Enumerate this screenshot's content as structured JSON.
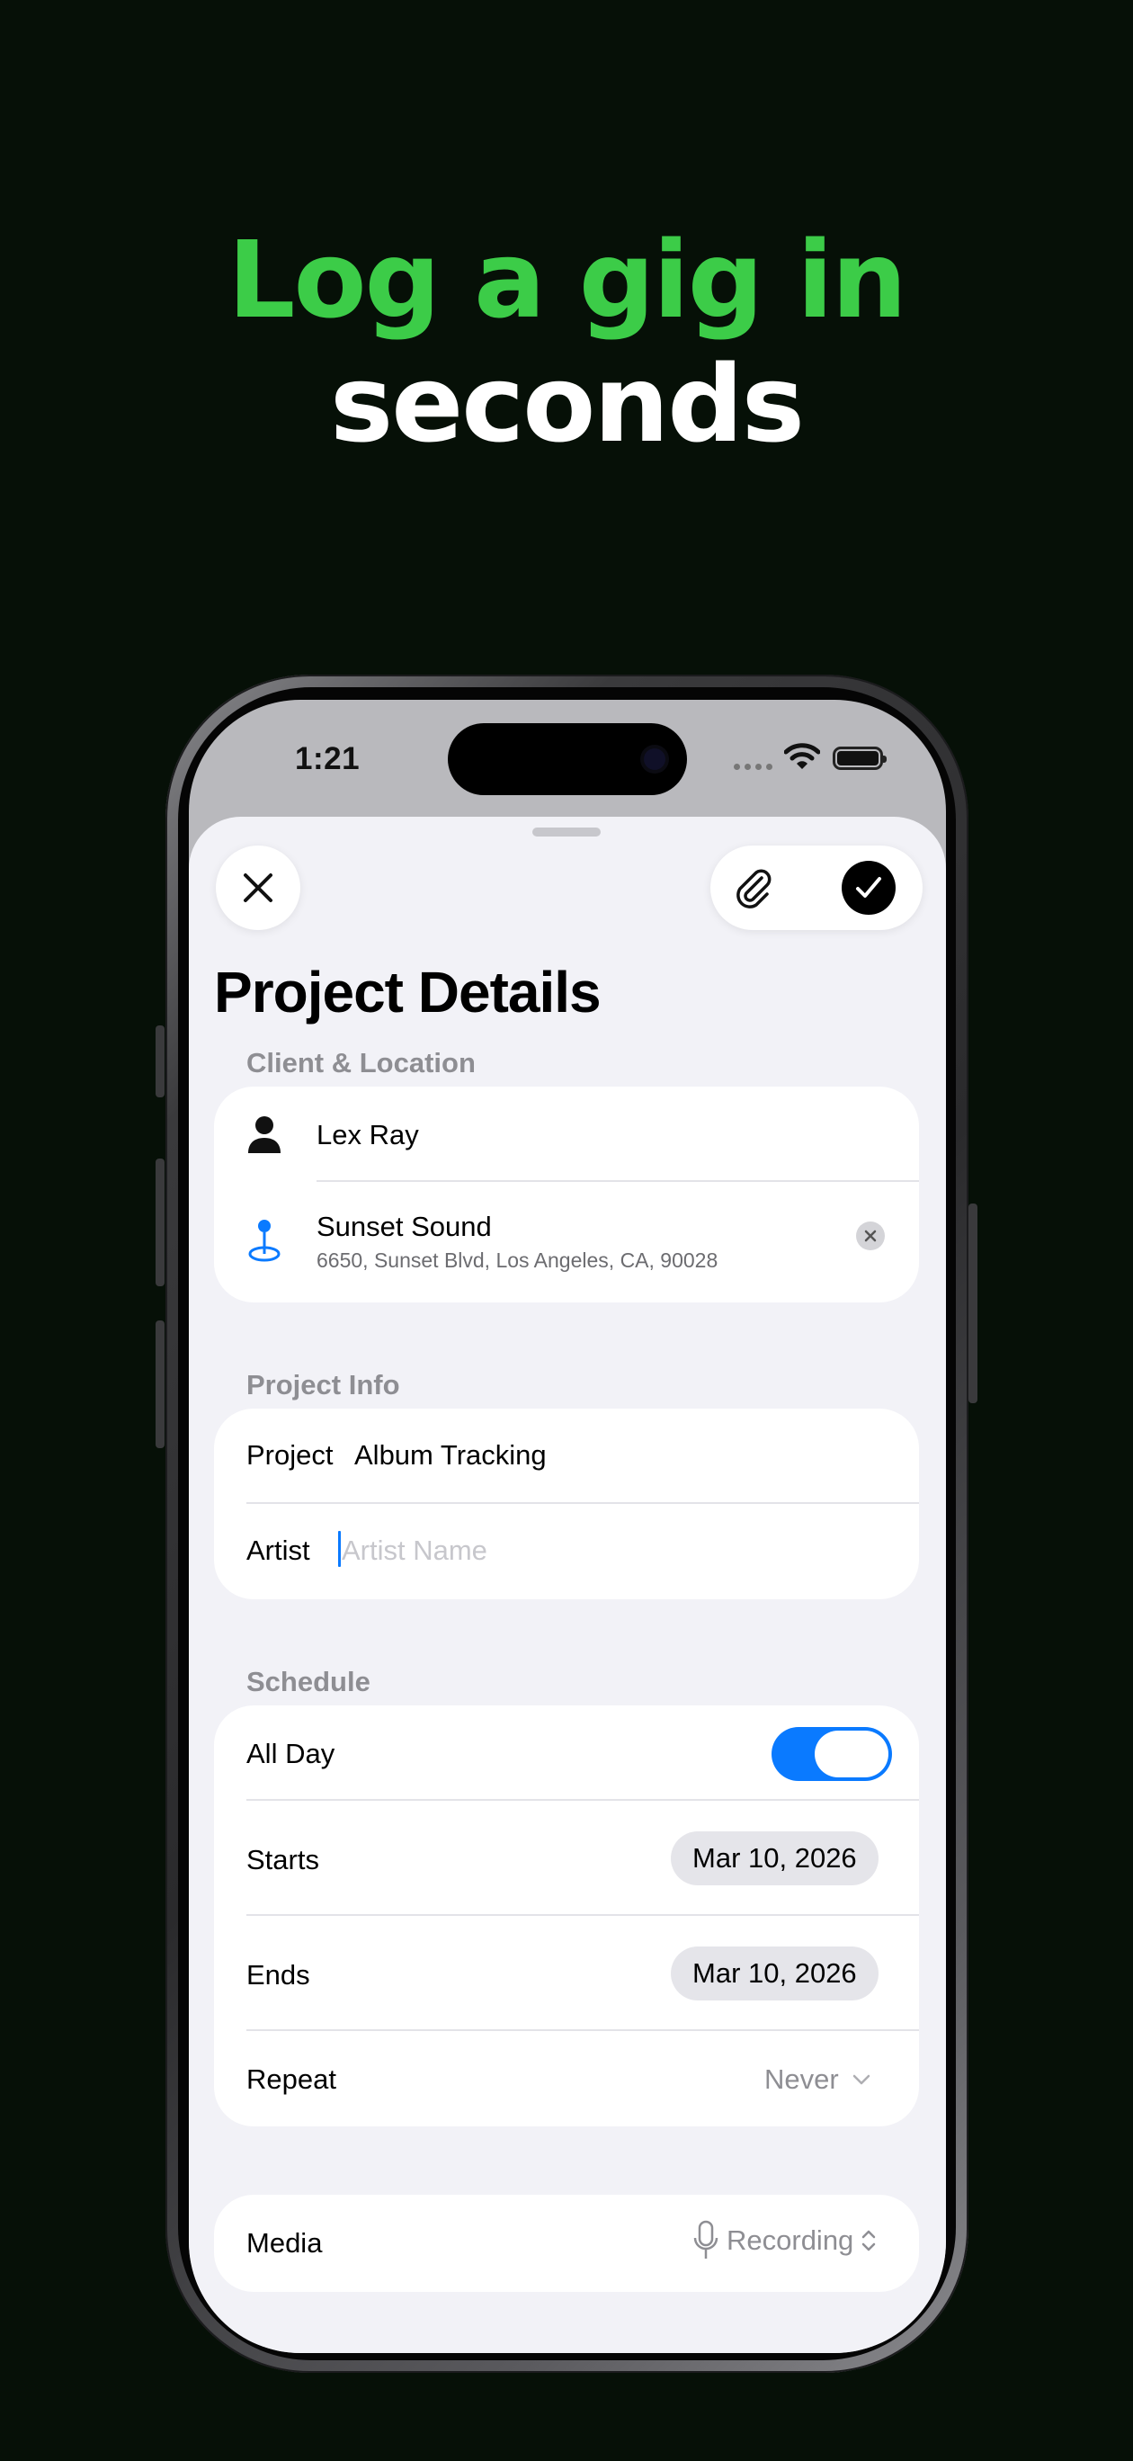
{
  "headline": {
    "line1": "Log a gig in",
    "line2": "seconds"
  },
  "status_bar": {
    "time": "1:21",
    "icons": [
      "signal-icon",
      "wifi-icon",
      "battery-icon"
    ]
  },
  "toolbar": {
    "close_icon": "close-icon",
    "attach_icon": "paperclip-icon",
    "confirm_icon": "checkmark-icon"
  },
  "page": {
    "title": "Project Details"
  },
  "client_location": {
    "header": "Client & Location",
    "client": {
      "icon": "person-icon",
      "name": "Lex Ray"
    },
    "location": {
      "icon": "map-pin-icon",
      "name": "Sunset Sound",
      "address": "6650, Sunset Blvd, Los Angeles, CA, 90028"
    }
  },
  "project_info": {
    "header": "Project Info",
    "project": {
      "label": "Project",
      "value": "Album Tracking"
    },
    "artist": {
      "label": "Artist",
      "value": "",
      "placeholder": "Artist Name"
    }
  },
  "schedule": {
    "header": "Schedule",
    "all_day": {
      "label": "All Day",
      "on": true
    },
    "starts": {
      "label": "Starts",
      "value": "Mar 10, 2026"
    },
    "ends": {
      "label": "Ends",
      "value": "Mar 10, 2026"
    },
    "repeat": {
      "label": "Repeat",
      "value": "Never"
    }
  },
  "media": {
    "label": "Media",
    "value": "Recording",
    "icon": "microphone-icon"
  },
  "colors": {
    "accent_green": "#3ccc48",
    "accent_blue": "#0a7aff",
    "background": "#061007"
  }
}
